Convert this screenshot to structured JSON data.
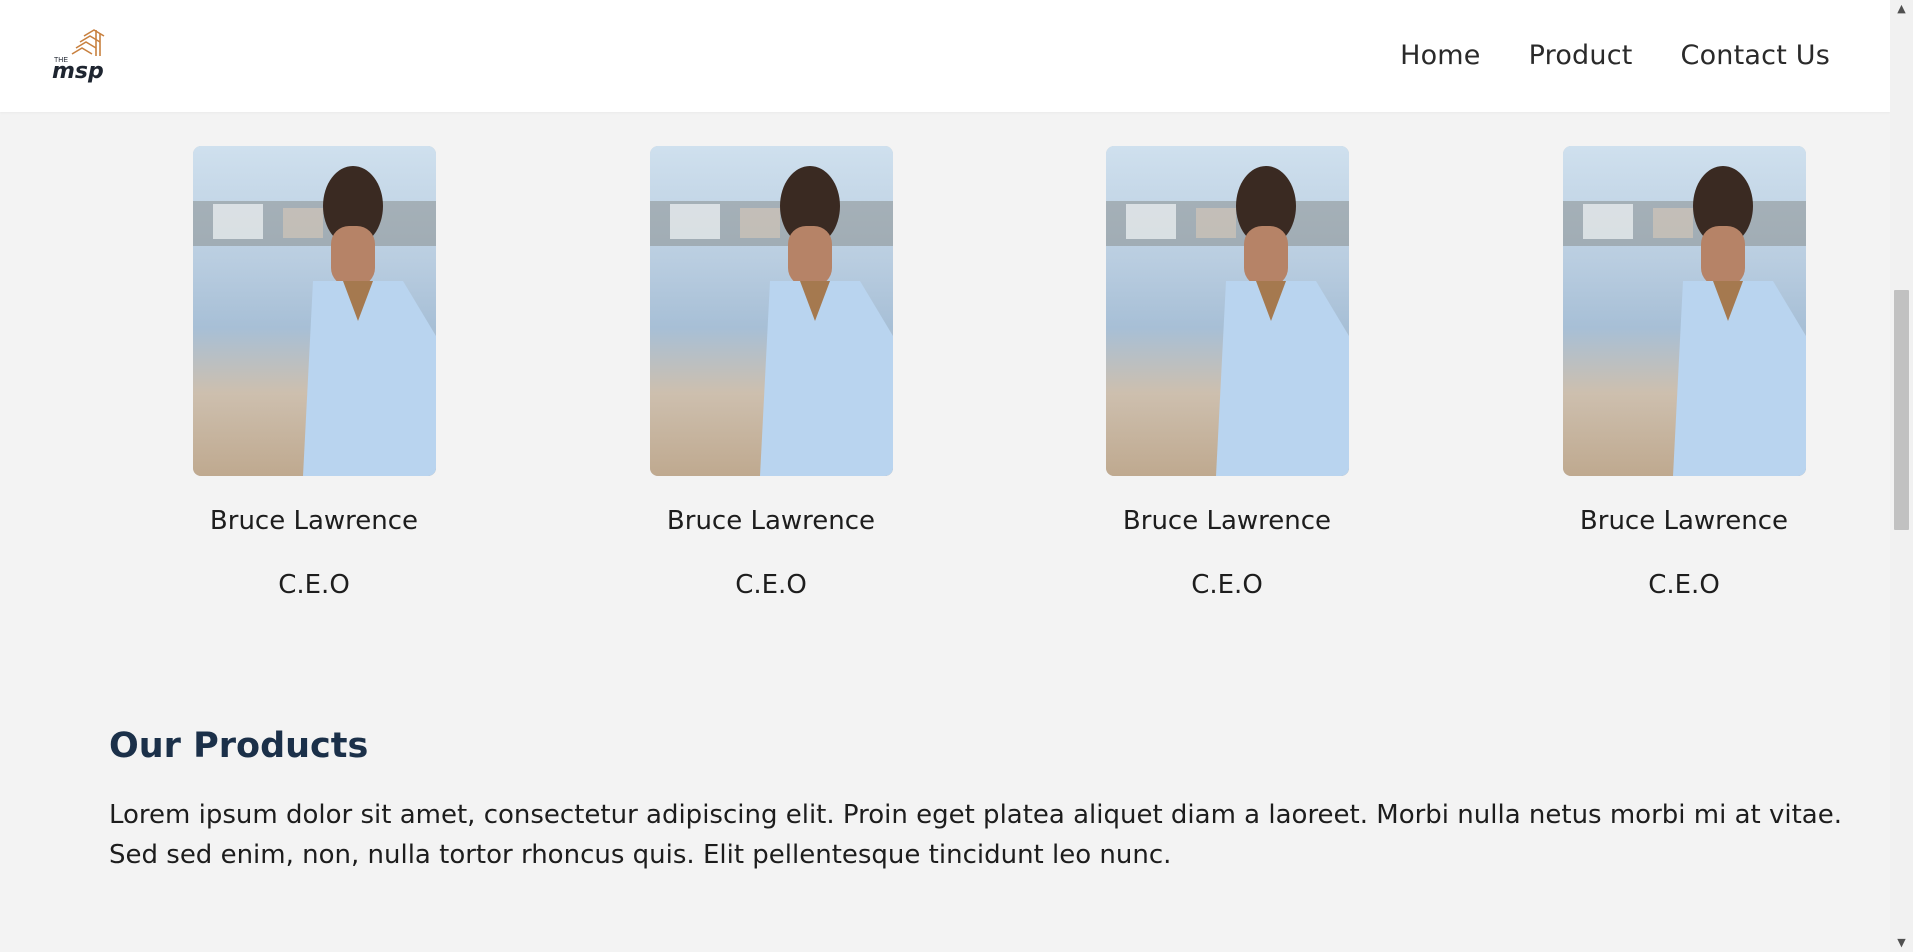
{
  "header": {
    "logo_name": "msp-logo",
    "logo_text": "msp",
    "nav": [
      {
        "label": "Home"
      },
      {
        "label": "Product"
      },
      {
        "label": "Contact Us"
      }
    ]
  },
  "team": {
    "members": [
      {
        "name": "Bruce Lawrence",
        "role": "C.E.O"
      },
      {
        "name": "Bruce Lawrence",
        "role": "C.E.O"
      },
      {
        "name": "Bruce Lawrence",
        "role": "C.E.O"
      },
      {
        "name": "Bruce Lawrence",
        "role": "C.E.O"
      }
    ]
  },
  "products": {
    "title": "Our Products",
    "description": "Lorem ipsum dolor sit amet, consectetur adipiscing elit. Proin eget platea aliquet diam a laoreet. Morbi nulla netus morbi mi at vitae. Sed sed enim, non, nulla tortor rhoncus quis. Elit pellentesque tincidunt leo nunc."
  },
  "colors": {
    "nav_bg": "#ffffff",
    "page_bg": "#f3f3f3",
    "heading": "#1b3049",
    "logo_accent": "#c8803f",
    "logo_dark": "#1e2530"
  }
}
